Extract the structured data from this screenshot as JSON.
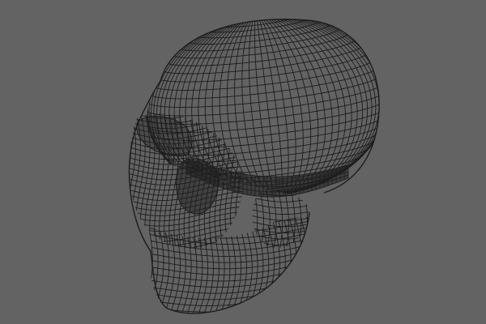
{
  "viewport": {
    "background_color": "#636363",
    "wire_color": "#1c1c1c",
    "shadow_color": "#202020",
    "subject": "wireframe-skull-mesh",
    "mesh_visible": true
  }
}
